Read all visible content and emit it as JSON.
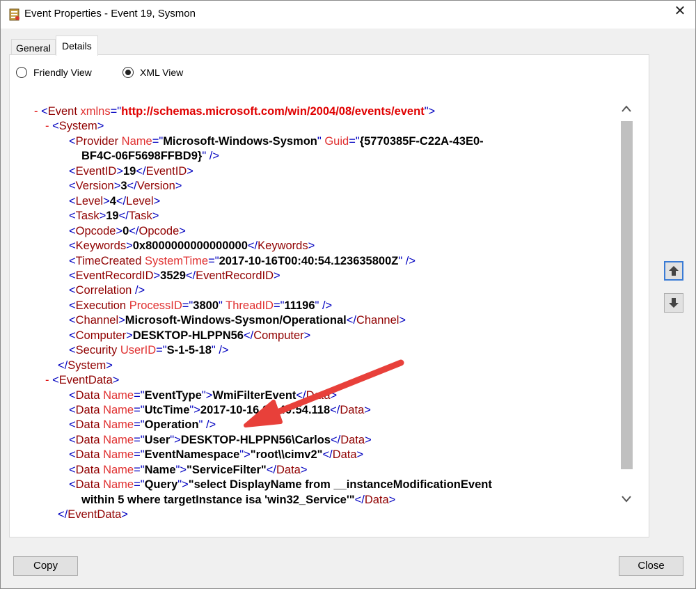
{
  "window": {
    "title": "Event Properties - Event 19, Sysmon",
    "close_glyph": "✕"
  },
  "tabs": [
    {
      "label": "General"
    },
    {
      "label": "Details"
    }
  ],
  "view_options": [
    {
      "label": "Friendly View",
      "checked": false
    },
    {
      "label": "XML View",
      "checked": true
    }
  ],
  "xml_lines": [
    [
      [
        "mk",
        "- "
      ],
      [
        "br",
        "<"
      ],
      [
        "tg",
        "Event "
      ],
      [
        "at",
        "xmlns"
      ],
      [
        "br",
        "=\""
      ],
      [
        "ns",
        "http://schemas.microsoft.com/win/2004/08/events/event"
      ],
      [
        "br",
        "\">"
      ]
    ],
    [
      [
        "mk",
        "- "
      ],
      [
        "br",
        "<"
      ],
      [
        "tg",
        "System"
      ],
      [
        "br",
        ">"
      ]
    ],
    [
      [
        "br",
        "<"
      ],
      [
        "tg",
        "Provider "
      ],
      [
        "at",
        "Name"
      ],
      [
        "br",
        "=\""
      ],
      [
        "vl",
        "Microsoft-Windows-Sysmon"
      ],
      [
        "br",
        "\" "
      ],
      [
        "at",
        "Guid"
      ],
      [
        "br",
        "=\""
      ],
      [
        "vl",
        "{5770385F-C22A-43E0-"
      ]
    ],
    [
      [
        "vl",
        "BF4C-06F5698FFBD9}"
      ],
      [
        "br",
        "\" />"
      ]
    ],
    [
      [
        "br",
        "<"
      ],
      [
        "tg",
        "EventID"
      ],
      [
        "br",
        ">"
      ],
      [
        "vl",
        "19"
      ],
      [
        "br",
        "</"
      ],
      [
        "tg",
        "EventID"
      ],
      [
        "br",
        ">"
      ]
    ],
    [
      [
        "br",
        "<"
      ],
      [
        "tg",
        "Version"
      ],
      [
        "br",
        ">"
      ],
      [
        "vl",
        "3"
      ],
      [
        "br",
        "</"
      ],
      [
        "tg",
        "Version"
      ],
      [
        "br",
        ">"
      ]
    ],
    [
      [
        "br",
        "<"
      ],
      [
        "tg",
        "Level"
      ],
      [
        "br",
        ">"
      ],
      [
        "vl",
        "4"
      ],
      [
        "br",
        "</"
      ],
      [
        "tg",
        "Level"
      ],
      [
        "br",
        ">"
      ]
    ],
    [
      [
        "br",
        "<"
      ],
      [
        "tg",
        "Task"
      ],
      [
        "br",
        ">"
      ],
      [
        "vl",
        "19"
      ],
      [
        "br",
        "</"
      ],
      [
        "tg",
        "Task"
      ],
      [
        "br",
        ">"
      ]
    ],
    [
      [
        "br",
        "<"
      ],
      [
        "tg",
        "Opcode"
      ],
      [
        "br",
        ">"
      ],
      [
        "vl",
        "0"
      ],
      [
        "br",
        "</"
      ],
      [
        "tg",
        "Opcode"
      ],
      [
        "br",
        ">"
      ]
    ],
    [
      [
        "br",
        "<"
      ],
      [
        "tg",
        "Keywords"
      ],
      [
        "br",
        ">"
      ],
      [
        "vl",
        "0x8000000000000000"
      ],
      [
        "br",
        "</"
      ],
      [
        "tg",
        "Keywords"
      ],
      [
        "br",
        ">"
      ]
    ],
    [
      [
        "br",
        "<"
      ],
      [
        "tg",
        "TimeCreated "
      ],
      [
        "at",
        "SystemTime"
      ],
      [
        "br",
        "=\""
      ],
      [
        "vl",
        "2017-10-16T00:40:54.123635800Z"
      ],
      [
        "br",
        "\" />"
      ]
    ],
    [
      [
        "br",
        "<"
      ],
      [
        "tg",
        "EventRecordID"
      ],
      [
        "br",
        ">"
      ],
      [
        "vl",
        "3529"
      ],
      [
        "br",
        "</"
      ],
      [
        "tg",
        "EventRecordID"
      ],
      [
        "br",
        ">"
      ]
    ],
    [
      [
        "br",
        "<"
      ],
      [
        "tg",
        "Correlation "
      ],
      [
        "br",
        "/>"
      ]
    ],
    [
      [
        "br",
        "<"
      ],
      [
        "tg",
        "Execution "
      ],
      [
        "at",
        "ProcessID"
      ],
      [
        "br",
        "=\""
      ],
      [
        "vl",
        "3800"
      ],
      [
        "br",
        "\" "
      ],
      [
        "at",
        "ThreadID"
      ],
      [
        "br",
        "=\""
      ],
      [
        "vl",
        "11196"
      ],
      [
        "br",
        "\" />"
      ]
    ],
    [
      [
        "br",
        "<"
      ],
      [
        "tg",
        "Channel"
      ],
      [
        "br",
        ">"
      ],
      [
        "vl",
        "Microsoft-Windows-Sysmon/Operational"
      ],
      [
        "br",
        "</"
      ],
      [
        "tg",
        "Channel"
      ],
      [
        "br",
        ">"
      ]
    ],
    [
      [
        "br",
        "<"
      ],
      [
        "tg",
        "Computer"
      ],
      [
        "br",
        ">"
      ],
      [
        "vl",
        "DESKTOP-HLPPN56"
      ],
      [
        "br",
        "</"
      ],
      [
        "tg",
        "Computer"
      ],
      [
        "br",
        ">"
      ]
    ],
    [
      [
        "br",
        "<"
      ],
      [
        "tg",
        "Security "
      ],
      [
        "at",
        "UserID"
      ],
      [
        "br",
        "=\""
      ],
      [
        "vl",
        "S-1-5-18"
      ],
      [
        "br",
        "\" />"
      ]
    ],
    [
      [
        "br",
        "</"
      ],
      [
        "tg",
        "System"
      ],
      [
        "br",
        ">"
      ]
    ],
    [
      [
        "mk",
        "- "
      ],
      [
        "br",
        "<"
      ],
      [
        "tg",
        "EventData"
      ],
      [
        "br",
        ">"
      ]
    ],
    [
      [
        "br",
        "<"
      ],
      [
        "tg",
        "Data "
      ],
      [
        "at",
        "Name"
      ],
      [
        "br",
        "=\""
      ],
      [
        "vl",
        "EventType"
      ],
      [
        "br",
        "\">"
      ],
      [
        "vl",
        "WmiFilterEvent"
      ],
      [
        "br",
        "</"
      ],
      [
        "tg",
        "Data"
      ],
      [
        "br",
        ">"
      ]
    ],
    [
      [
        "br",
        "<"
      ],
      [
        "tg",
        "Data "
      ],
      [
        "at",
        "Name"
      ],
      [
        "br",
        "=\""
      ],
      [
        "vl",
        "UtcTime"
      ],
      [
        "br",
        "\">"
      ],
      [
        "vl",
        "2017-10-16 00:40:54.118"
      ],
      [
        "br",
        "</"
      ],
      [
        "tg",
        "Data"
      ],
      [
        "br",
        ">"
      ]
    ],
    [
      [
        "br",
        "<"
      ],
      [
        "tg",
        "Data "
      ],
      [
        "at",
        "Name"
      ],
      [
        "br",
        "=\""
      ],
      [
        "vl",
        "Operation"
      ],
      [
        "br",
        "\" />"
      ]
    ],
    [
      [
        "br",
        "<"
      ],
      [
        "tg",
        "Data "
      ],
      [
        "at",
        "Name"
      ],
      [
        "br",
        "=\""
      ],
      [
        "vl",
        "User"
      ],
      [
        "br",
        "\">"
      ],
      [
        "vl",
        "DESKTOP-HLPPN56\\Carlos"
      ],
      [
        "br",
        "</"
      ],
      [
        "tg",
        "Data"
      ],
      [
        "br",
        ">"
      ]
    ],
    [
      [
        "br",
        "<"
      ],
      [
        "tg",
        "Data "
      ],
      [
        "at",
        "Name"
      ],
      [
        "br",
        "=\""
      ],
      [
        "vl",
        "EventNamespace"
      ],
      [
        "br",
        "\">"
      ],
      [
        "vl",
        "\"root\\\\cimv2\""
      ],
      [
        "br",
        "</"
      ],
      [
        "tg",
        "Data"
      ],
      [
        "br",
        ">"
      ]
    ],
    [
      [
        "br",
        "<"
      ],
      [
        "tg",
        "Data "
      ],
      [
        "at",
        "Name"
      ],
      [
        "br",
        "=\""
      ],
      [
        "vl",
        "Name"
      ],
      [
        "br",
        "\">"
      ],
      [
        "vl",
        "\"ServiceFilter\""
      ],
      [
        "br",
        "</"
      ],
      [
        "tg",
        "Data"
      ],
      [
        "br",
        ">"
      ]
    ],
    [
      [
        "br",
        "<"
      ],
      [
        "tg",
        "Data "
      ],
      [
        "at",
        "Name"
      ],
      [
        "br",
        "=\""
      ],
      [
        "vl",
        "Query"
      ],
      [
        "br",
        "\">"
      ],
      [
        "vl",
        "\"select DisplayName from __instanceModificationEvent"
      ]
    ],
    [
      [
        "vl",
        "within 5 where targetInstance isa 'win32_Service'\""
      ],
      [
        "br",
        "</"
      ],
      [
        "tg",
        "Data"
      ],
      [
        "br",
        ">"
      ]
    ],
    [
      [
        "br",
        "</"
      ],
      [
        "tg",
        "EventData"
      ],
      [
        "br",
        ">"
      ]
    ]
  ],
  "buttons": {
    "copy": "Copy",
    "close": "Close"
  },
  "colors": {
    "annotation_arrow": "#e8403a",
    "tag": "#900000",
    "attribute": "#e03030",
    "bracket": "#0000c0",
    "namespace": "#e00000"
  },
  "icons": {
    "scroll_up": "scroll-up-arrow-icon",
    "scroll_down": "scroll-down-arrow-icon",
    "prev_event": "up-arrow-icon",
    "next_event": "down-arrow-icon",
    "window_icon": "event-viewer-icon"
  }
}
